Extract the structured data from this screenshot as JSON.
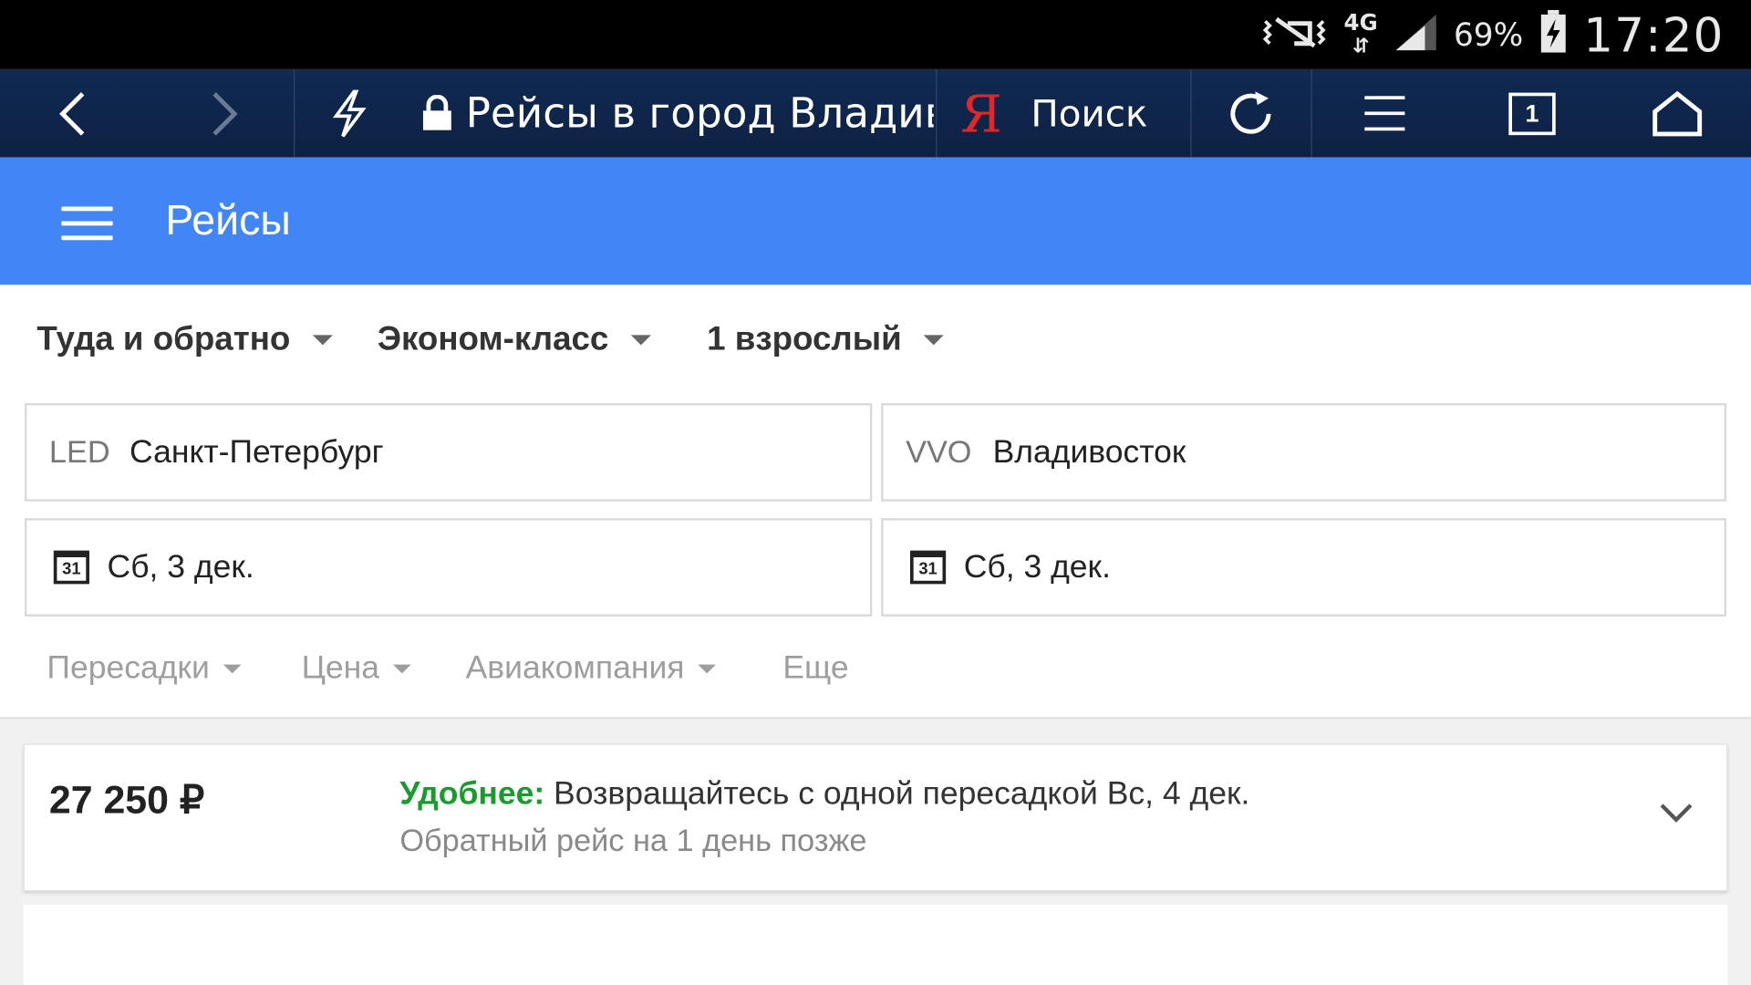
{
  "status_bar": {
    "network": "4G",
    "battery": "69%",
    "time": "17:20"
  },
  "browser": {
    "url_title": "Рейсы в город Владив",
    "yandex_letter": "Я",
    "search_label": "Поиск",
    "tabs_count": "1"
  },
  "app": {
    "title": "Рейсы"
  },
  "search_options": {
    "trip_type": "Туда и обратно",
    "cabin_class": "Эконом-класс",
    "passengers": "1 взрослый"
  },
  "route": {
    "origin_code": "LED",
    "origin_city": "Санкт-Петербург",
    "destination_code": "VVO",
    "destination_city": "Владивосток"
  },
  "dates": {
    "calendar_icon_text": "31",
    "departure": "Сб, 3 дек.",
    "return": "Сб, 3 дек."
  },
  "filters": {
    "stops": "Пересадки",
    "price": "Цена",
    "airline": "Авиакомпания",
    "more": "Еще"
  },
  "result": {
    "price": "27 250 ₽",
    "highlight_label": "Удобнее:",
    "highlight_text": " Возвращайтесь с одной пересадкой Вс, 4 дек.",
    "subtext": "Обратный рейс на 1 день позже"
  },
  "colors": {
    "app_bar": "#4285f4",
    "browser_bar": "#0f2446",
    "highlight_green": "#1a9a2f",
    "yandex_red": "#e3262a"
  }
}
